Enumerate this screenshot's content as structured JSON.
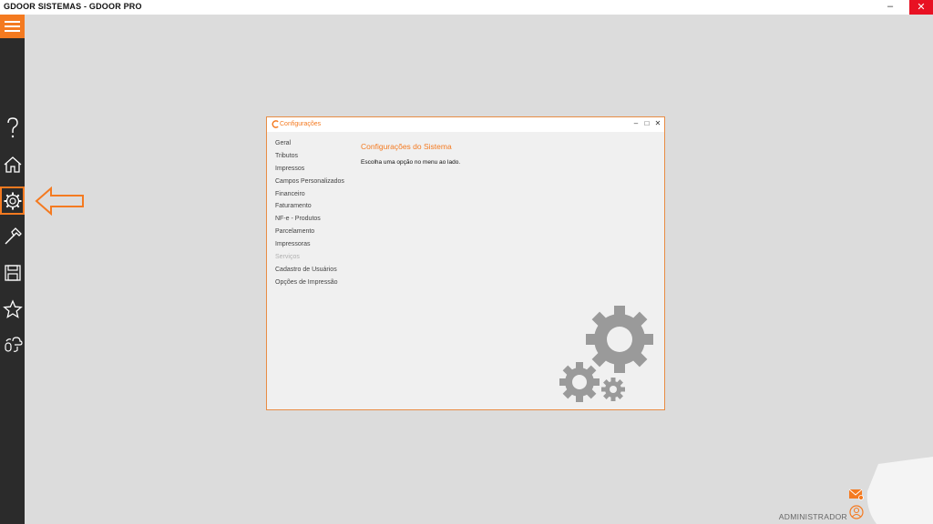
{
  "window": {
    "title": "GDOOR SISTEMAS - GDOOR PRO",
    "minimize_glyph": "–",
    "close_glyph": "✕"
  },
  "sidebar": {
    "items": [
      {
        "icon": "menu-icon"
      },
      {
        "icon": "help-icon"
      },
      {
        "icon": "home-icon"
      },
      {
        "icon": "gear-icon",
        "active": true
      },
      {
        "icon": "hammer-icon"
      },
      {
        "icon": "save-icon"
      },
      {
        "icon": "star-icon"
      },
      {
        "icon": "sync-cloud-icon"
      }
    ]
  },
  "dialog": {
    "title": "Configurações",
    "controls": {
      "minimize": "–",
      "maximize": "□",
      "close": "✕"
    },
    "menu": [
      {
        "label": "Geral"
      },
      {
        "label": "Tributos"
      },
      {
        "label": "Impressos"
      },
      {
        "label": "Campos Personalizados"
      },
      {
        "label": "Financeiro"
      },
      {
        "label": "Faturamento"
      },
      {
        "label": "NF-e - Produtos"
      },
      {
        "label": "Parcelamento"
      },
      {
        "label": "Impressoras"
      },
      {
        "label": "Serviços",
        "disabled": true
      },
      {
        "label": "Cadastro de Usuários"
      },
      {
        "label": "Opções de Impressão"
      }
    ],
    "heading": "Configurações do Sistema",
    "hint": "Escolha uma opção no menu ao lado."
  },
  "footer": {
    "user": "ADMINISTRADOR"
  },
  "colors": {
    "accent": "#f47a20",
    "sidebar": "#2b2b2b",
    "background": "#dcdcdc",
    "close": "#e81123"
  }
}
